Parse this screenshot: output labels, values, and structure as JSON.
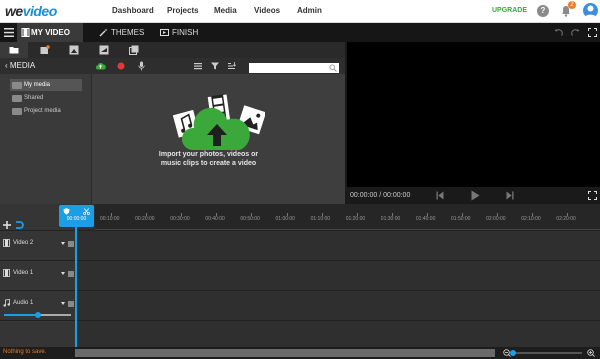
{
  "topnav": {
    "logo": {
      "part1": "we",
      "part2": "video"
    },
    "links": [
      "Dashboard",
      "Projects",
      "Media",
      "Videos",
      "Admin"
    ],
    "upgrade": "UPGRADE",
    "help_glyph": "?",
    "notification_count": "2",
    "brand_color": "#1a8fd6",
    "upgrade_color": "#3aa83a"
  },
  "tabbar": {
    "tabs": [
      {
        "label": "MY VIDEO",
        "icon": "film-icon",
        "active": true
      },
      {
        "label": "THEMES",
        "icon": "wand-icon",
        "active": false
      },
      {
        "label": "FINISH",
        "icon": "export-icon",
        "active": false
      }
    ]
  },
  "media": {
    "header": "MEDIA",
    "folders": [
      {
        "label": "My media",
        "selected": true
      },
      {
        "label": "Shared",
        "selected": false
      },
      {
        "label": "Project media",
        "selected": false
      }
    ],
    "search_placeholder": "",
    "import_text_line1": "Import your photos, videos or",
    "import_text_line2": "music clips to create a video"
  },
  "preview": {
    "timecode": "00:00:00 / 00:00:00"
  },
  "timeline": {
    "playhead_time": "00:00:00",
    "ticks": [
      "00:10:00",
      "00:20:00",
      "00:30:00",
      "00:40:00",
      "00:50:00",
      "01:00:00",
      "01:10:00",
      "01:20:00",
      "01:30:00",
      "01:40:00",
      "01:50:00",
      "02:00:00",
      "02:10:00",
      "02:20:00"
    ],
    "tracks": [
      {
        "label": "Video 2",
        "type": "video"
      },
      {
        "label": "Video 1",
        "type": "video"
      },
      {
        "label": "Audio 1",
        "type": "audio"
      }
    ],
    "audio_volume": 0.5,
    "accent_color": "#1a9ee6"
  },
  "statusbar": {
    "status_text": "Nothing to save.",
    "zoom_level": 0.02
  }
}
